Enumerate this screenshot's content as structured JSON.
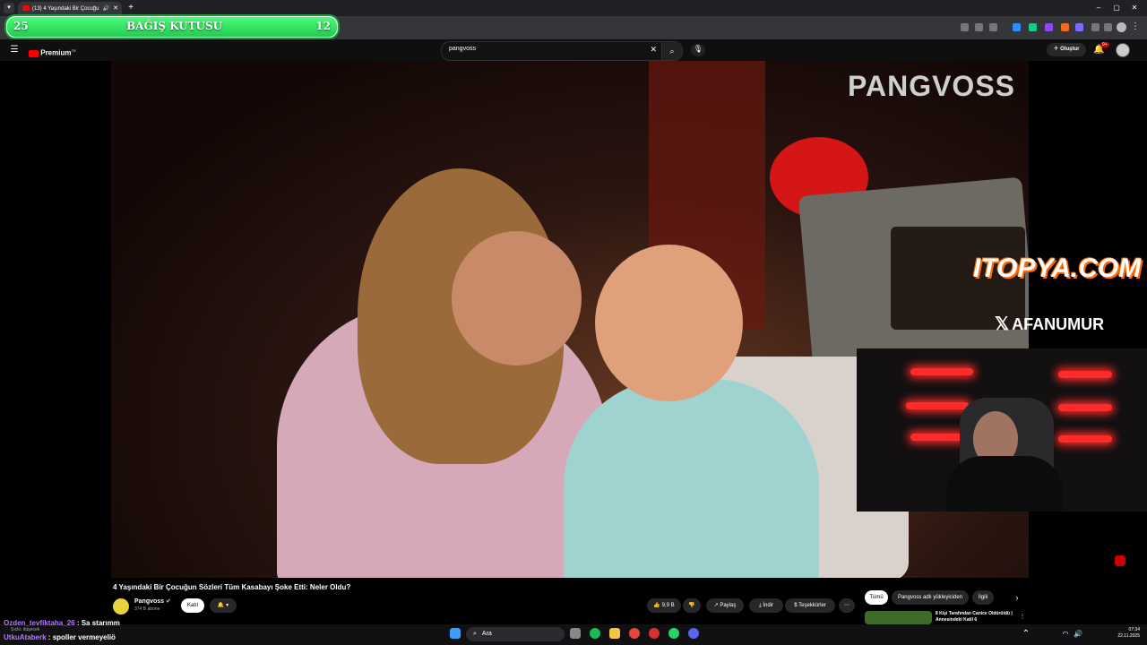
{
  "browser": {
    "tab_title": "(13) 4 Yaşındaki Bir Çocuğu",
    "new_tab": "+"
  },
  "donation": {
    "left_count": "25",
    "label": "BAĞIŞ KUTUSU",
    "right_count": "12"
  },
  "youtube": {
    "logo": "Premium",
    "logo_sup": "TR",
    "search_value": "pangvoss",
    "create_label": "Oluştur",
    "notif_badge": "9+"
  },
  "video": {
    "watermark": "PANGVOSS",
    "title": "4 Yaşındaki Bir Çocuğun Sözleri Tüm Kasabayı Şoke Etti: Neler Oldu?"
  },
  "channel": {
    "name": "Pangvoss",
    "subs": "374 B abone",
    "join_label": "Katıl"
  },
  "actions": {
    "likes": "9,9 B",
    "share": "Paylaş",
    "download": "İndir",
    "thanks": "Teşekkürler"
  },
  "filters": [
    "Tümü",
    "Pangvoss adlı yükleyiciden",
    "İlgili"
  ],
  "recommendation": {
    "title": "8 Kişi Tarafından Canice Öldürüldü | Annesindeki Katil 6"
  },
  "overlays": {
    "sponsor": "ITOPYA.COM",
    "x_handle": "AFANUMUR"
  },
  "chat": [
    {
      "user": "Ozden_tevfiktaha_26",
      "text": "Sa starımm",
      "user_color": "#b57bff"
    },
    {
      "user": "UtkuAtaberk",
      "text": "spoller vermeyeliö",
      "user_color": "#b57bff"
    }
  ],
  "chat_sub": "Sıcki. düşecek",
  "taskbar": {
    "search_placeholder": "Ara",
    "time": "07:34",
    "date": "22.11.2025"
  }
}
